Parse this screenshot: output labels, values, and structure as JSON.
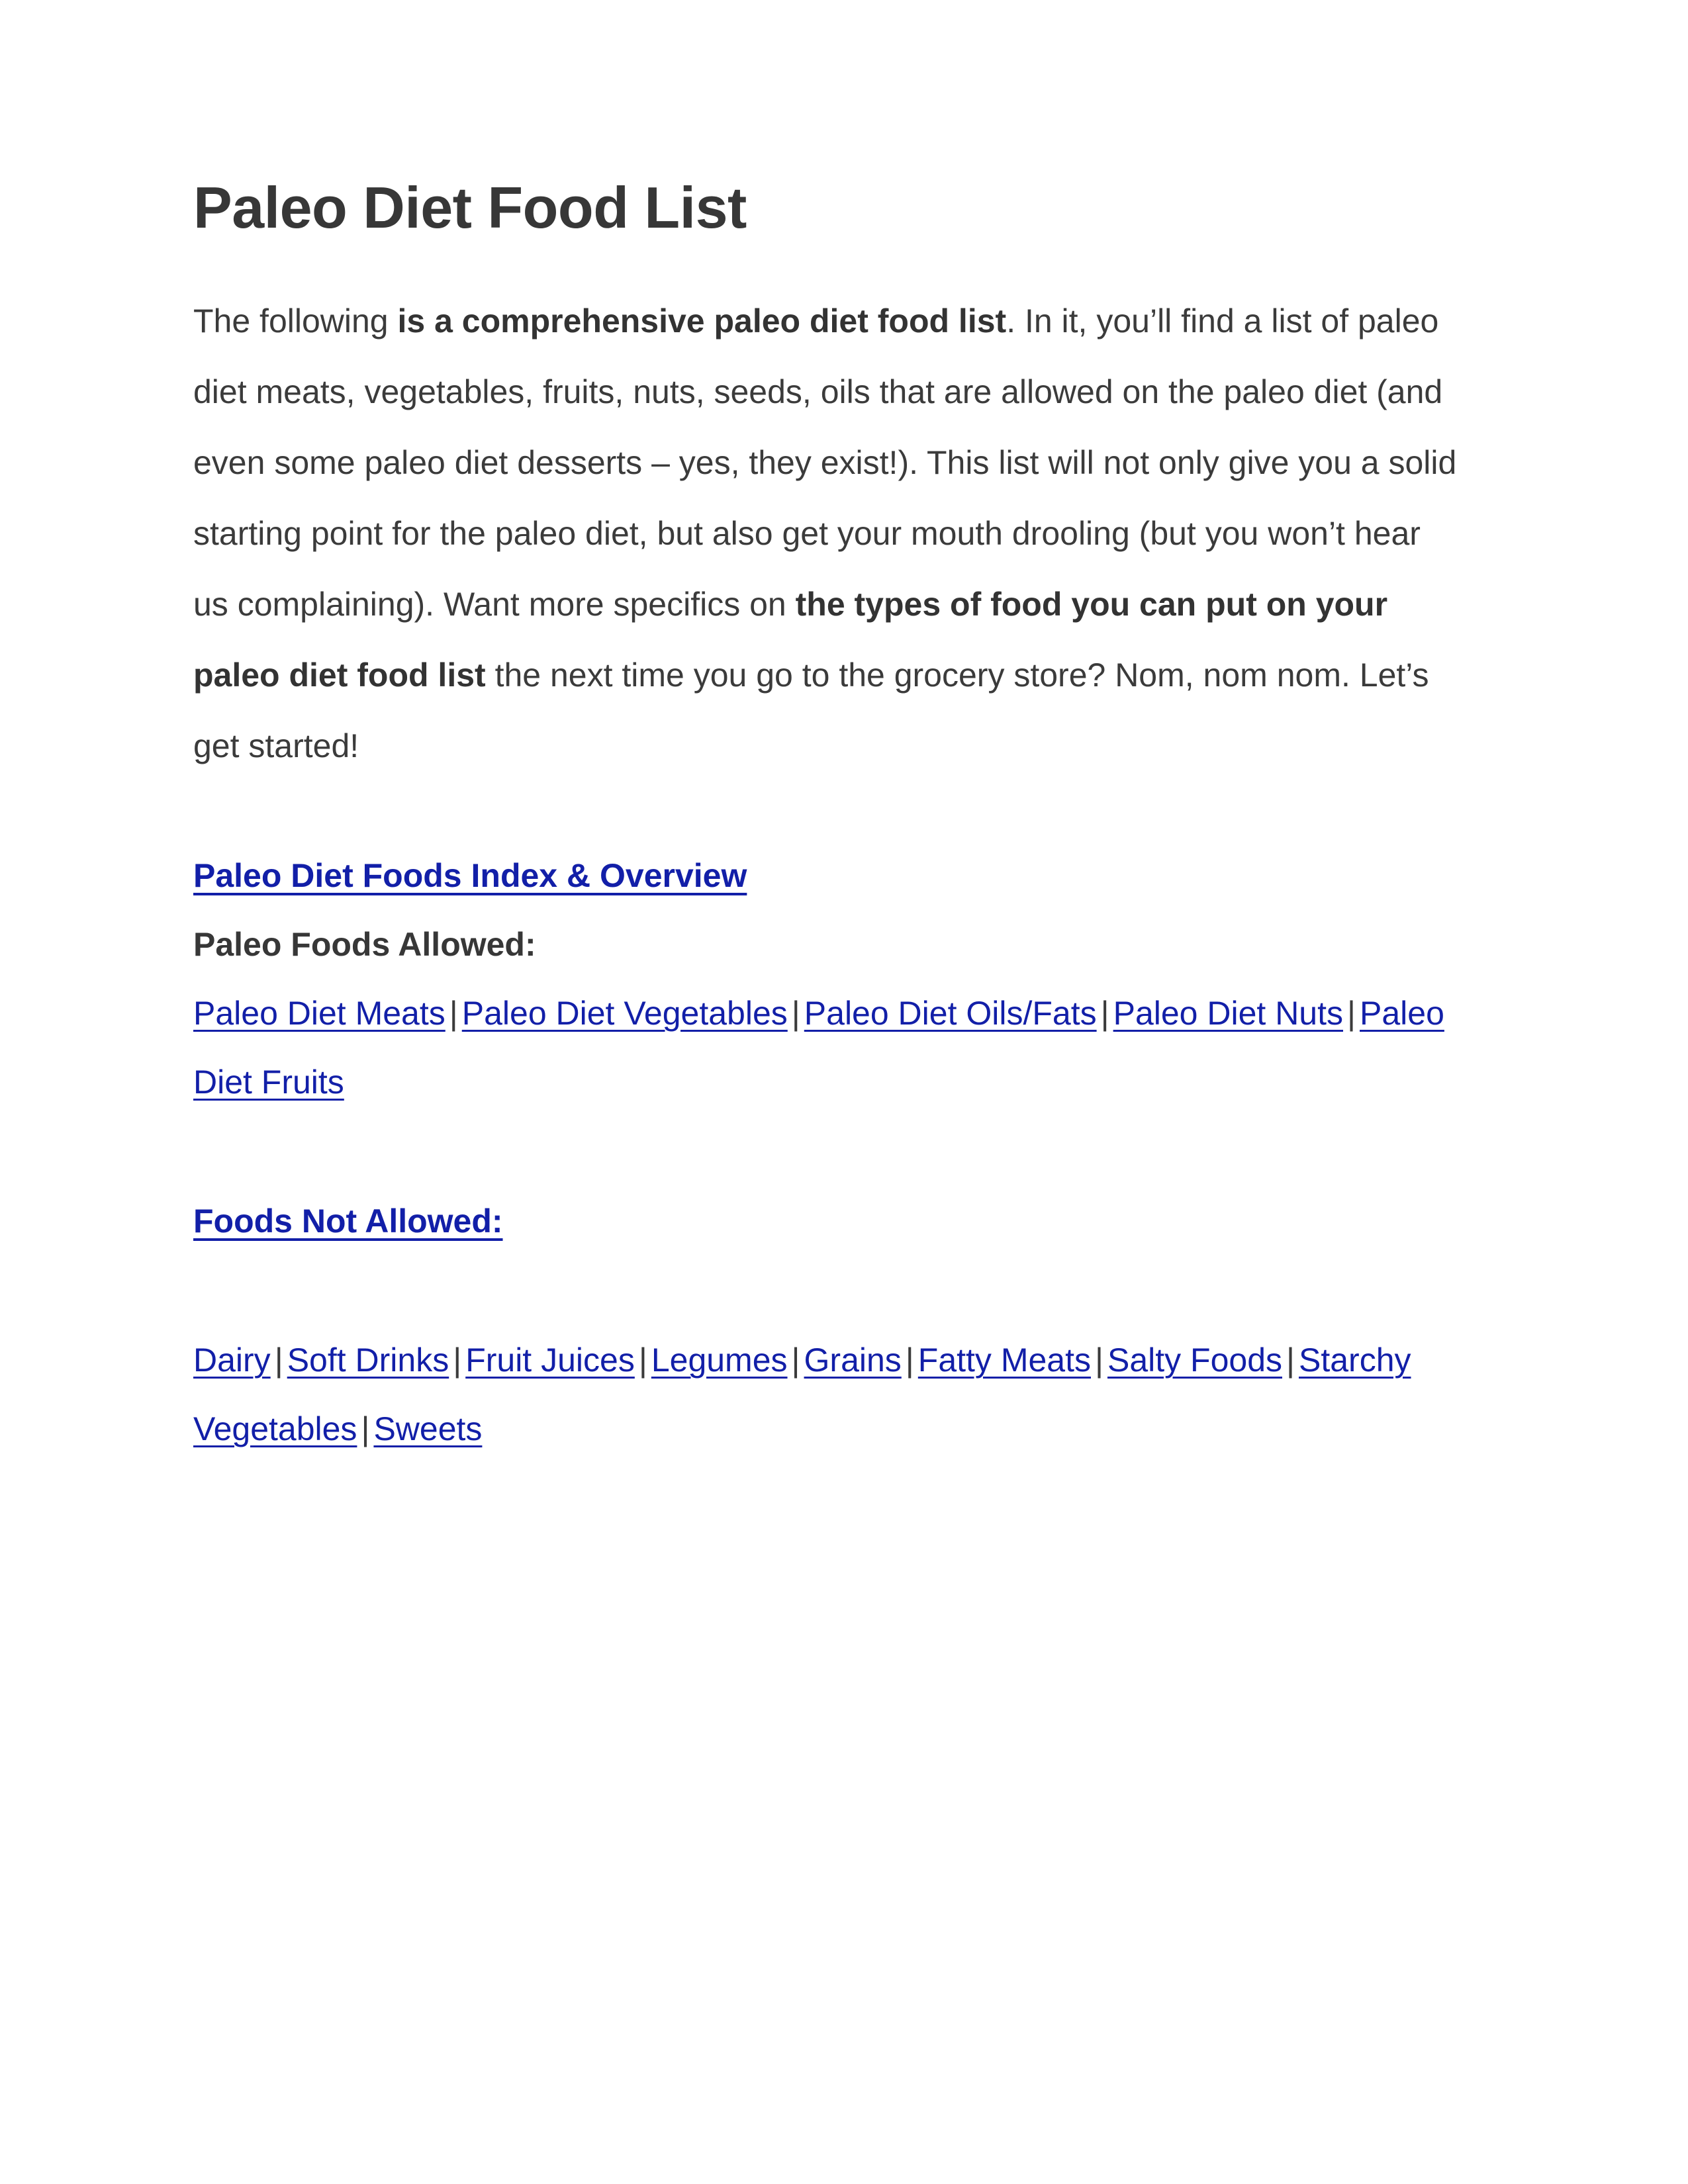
{
  "document": {
    "title": "Paleo Diet Food List",
    "intro": {
      "part1": "The following ",
      "bold1": "is a comprehensive paleo diet food list",
      "part2": ". In it, you’ll find a list of paleo diet meats, vegetables, fruits, nuts, seeds, oils that are allowed on the paleo diet (and even some paleo diet desserts – yes, they exist!). This list will not only give you a solid starting point for the paleo diet, but also get your mouth drooling (but you won’t hear us complaining). Want more specifics on ",
      "bold2": "the types of food you can put on your paleo diet food list",
      "part3": " the next time you go to the grocery store? Nom, nom nom. Let’s get started!"
    },
    "index_heading": "Paleo Diet Foods Index & Overview",
    "allowed": {
      "heading": "Paleo Foods Allowed:",
      "links": [
        "Paleo Diet Meats",
        "Paleo Diet Vegetables",
        "Paleo Diet Oils/Fats",
        "Paleo Diet Nuts",
        "Paleo Diet Fruits"
      ]
    },
    "not_allowed": {
      "heading": "Foods Not Allowed:",
      "links": [
        "Dairy",
        "Soft Drinks",
        "Fruit Juices",
        "Legumes",
        "Grains",
        "Fatty Meats",
        "Salty Foods",
        "Starchy Vegetables",
        "Sweets"
      ]
    },
    "separator": "|",
    "colors": {
      "link": "#121fa8",
      "title": "#373737",
      "body": "#3b3b3b",
      "background": "#ffffff"
    }
  }
}
